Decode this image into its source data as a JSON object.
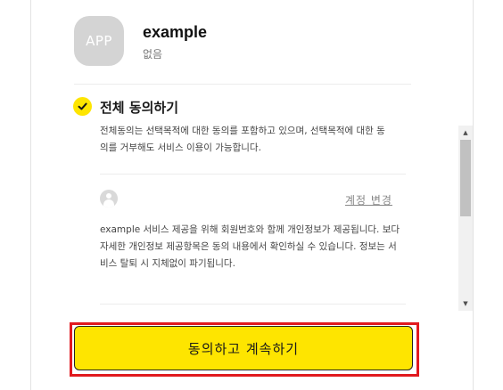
{
  "app": {
    "icon_text": "APP",
    "name": "example",
    "subtitle": "없음"
  },
  "consent": {
    "all_agree_label": "전체 동의하기",
    "all_agree_description": "전체동의는 선택목적에 대한 동의를 포함하고 있으며, 선택목적에 대한 동의를 거부해도 서비스 이용이 가능합니다.",
    "change_account_label": "계정 변경",
    "provide_description": "example 서비스 제공을 위해 회원번호와 함께 개인정보가 제공됩니다. 보다 자세한 개인정보 제공항목은 동의 내용에서 확인하실 수 있습니다. 정보는 서비스 탈퇴 시 지체없이 파기됩니다."
  },
  "actions": {
    "continue_label": "동의하고 계속하기"
  },
  "icons": {
    "all_agree": "check-circle-icon",
    "account": "user-avatar-icon",
    "scroll_up": "arrow-up-icon",
    "scroll_down": "arrow-down-icon"
  },
  "colors": {
    "accent": "#FEE500",
    "highlight": "#E1191E"
  }
}
